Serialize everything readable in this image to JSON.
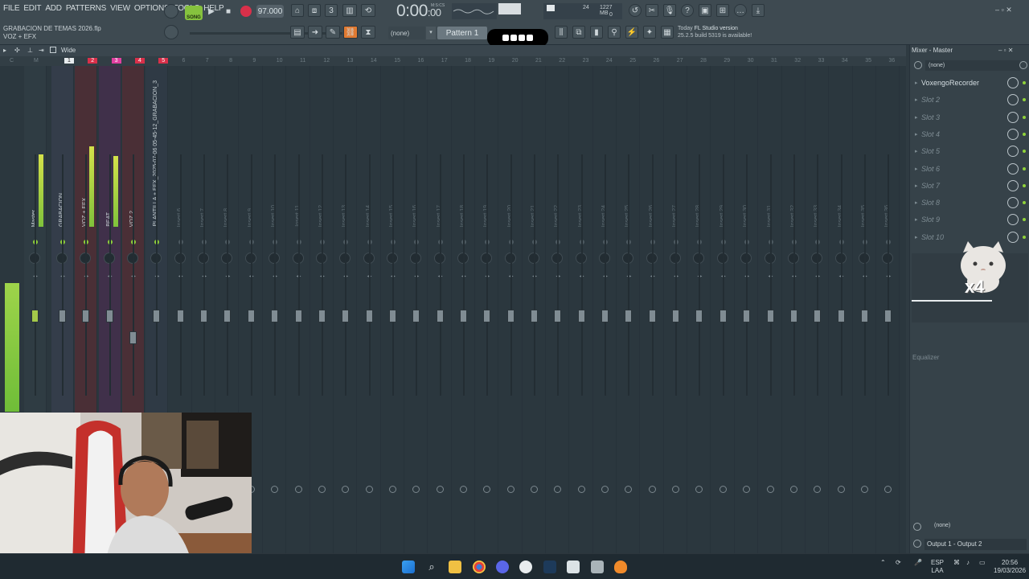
{
  "menu": [
    "FILE",
    "EDIT",
    "ADD",
    "PATTERNS",
    "VIEW",
    "OPTIONS",
    "TOOLS",
    "HELP"
  ],
  "project": {
    "file": "GRABACION DE TEMAS 2026.flp",
    "channel": "VOZ + EFX"
  },
  "transport": {
    "mode": "SONG",
    "tempo": "97.000",
    "time": "0:00",
    "time_small": ":00",
    "time_unit": "M:S:CS"
  },
  "cpu": {
    "value": "24",
    "memory": "1227 MB",
    "voices": "0"
  },
  "pattern": {
    "selector": "(none)",
    "name": "Pattern 1"
  },
  "news": {
    "date": "Today",
    "title": "FL Studio version",
    "body": "25.2.5 build 5319 is available!"
  },
  "mixer": {
    "view": "Wide",
    "tracks": [
      {
        "label": "Master",
        "active": true
      },
      {
        "label": "GRABACION",
        "active": true
      },
      {
        "label": "VOZ + EFX",
        "active": true
      },
      {
        "label": "BEAT",
        "active": true
      },
      {
        "label": "VOZ 2",
        "active": true
      },
      {
        "label": "PLANTILLA + EFX_2025-07-06 05-45-12_GRABACION_3",
        "active": true
      },
      {
        "label": "Insert 6"
      },
      {
        "label": "Insert 7"
      },
      {
        "label": "Insert 8"
      },
      {
        "label": "Insert 9"
      },
      {
        "label": "Insert 10"
      },
      {
        "label": "Insert 11"
      },
      {
        "label": "Insert 12"
      },
      {
        "label": "Insert 13"
      },
      {
        "label": "Insert 14"
      },
      {
        "label": "Insert 15"
      },
      {
        "label": "Insert 16"
      },
      {
        "label": "Insert 17"
      },
      {
        "label": "Insert 18"
      },
      {
        "label": "Insert 19"
      },
      {
        "label": "Insert 20"
      },
      {
        "label": "Insert 21"
      },
      {
        "label": "Insert 22"
      },
      {
        "label": "Insert 23"
      },
      {
        "label": "Insert 24"
      },
      {
        "label": "Insert 25"
      },
      {
        "label": "Insert 26"
      },
      {
        "label": "Insert 27"
      },
      {
        "label": "Insert 28"
      },
      {
        "label": "Insert 29"
      },
      {
        "label": "Insert 30"
      },
      {
        "label": "Insert 31"
      },
      {
        "label": "Insert 32"
      },
      {
        "label": "Insert 33"
      },
      {
        "label": "Insert 34"
      },
      {
        "label": "Insert 35"
      },
      {
        "label": "Insert 36"
      }
    ],
    "ruler": [
      "C",
      "M",
      "1",
      "2",
      "3",
      "4",
      "5",
      "6",
      "7",
      "8",
      "9",
      "10",
      "11",
      "12",
      "13",
      "14",
      "15",
      "16",
      "17",
      "18",
      "19",
      "20",
      "21",
      "22",
      "23",
      "24",
      "25",
      "26",
      "27",
      "28",
      "29",
      "30",
      "31",
      "32",
      "33",
      "34",
      "35",
      "36"
    ]
  },
  "fx_panel": {
    "title": "Mixer - Master",
    "preset": "(none)",
    "slots": [
      "VoxengoRecorder",
      "Slot 2",
      "Slot 3",
      "Slot 4",
      "Slot 5",
      "Slot 6",
      "Slot 7",
      "Slot 8",
      "Slot 9",
      "Slot 10"
    ],
    "equalizer_label": "Equalizer",
    "bottom_preset": "(none)",
    "output": "Output 1 - Output 2"
  },
  "overlay": {
    "cat_text": "x4"
  },
  "taskbar": {
    "lang": "ESP",
    "layout": "LAA",
    "time": "20:56",
    "date": "19/03/2026"
  },
  "colors": {
    "accent_green": "#86c23e",
    "meter": "#9ed44a",
    "track_red": "#d9304a",
    "track_pink": "#e040a0"
  }
}
